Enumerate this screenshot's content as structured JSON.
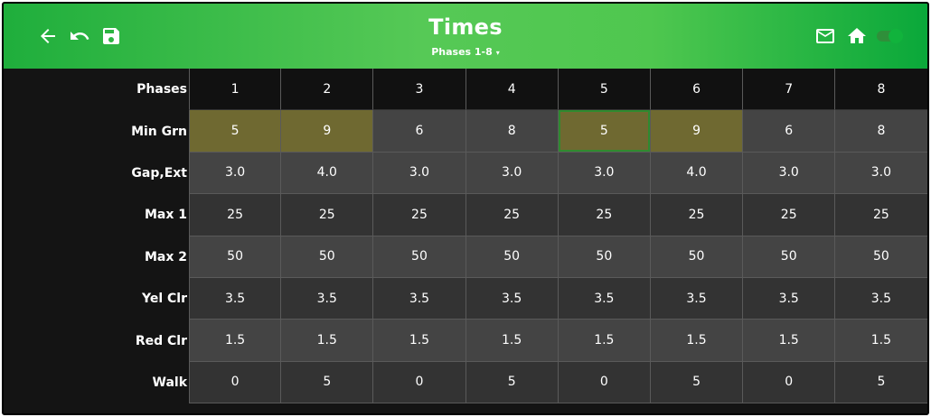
{
  "header": {
    "title": "Times",
    "subtitle": "Phases 1-8",
    "subtitle_caret": "▾"
  },
  "colors": {
    "header_green": "#4fc74f",
    "highlight_cell": "#6f6931",
    "selected_border": "#2f8a2f"
  },
  "table": {
    "header_label": "Phases",
    "phases": [
      "1",
      "2",
      "3",
      "4",
      "5",
      "6",
      "7",
      "8"
    ],
    "rows": [
      {
        "label": "Min Grn",
        "values": [
          "5",
          "9",
          "6",
          "8",
          "5",
          "9",
          "6",
          "8"
        ]
      },
      {
        "label": "Gap,Ext",
        "values": [
          "3.0",
          "4.0",
          "3.0",
          "3.0",
          "3.0",
          "4.0",
          "3.0",
          "3.0"
        ]
      },
      {
        "label": "Max 1",
        "values": [
          "25",
          "25",
          "25",
          "25",
          "25",
          "25",
          "25",
          "25"
        ]
      },
      {
        "label": "Max 2",
        "values": [
          "50",
          "50",
          "50",
          "50",
          "50",
          "50",
          "50",
          "50"
        ]
      },
      {
        "label": "Yel Clr",
        "values": [
          "3.5",
          "3.5",
          "3.5",
          "3.5",
          "3.5",
          "3.5",
          "3.5",
          "3.5"
        ]
      },
      {
        "label": "Red Clr",
        "values": [
          "1.5",
          "1.5",
          "1.5",
          "1.5",
          "1.5",
          "1.5",
          "1.5",
          "1.5"
        ]
      },
      {
        "label": "Walk",
        "values": [
          "0",
          "5",
          "0",
          "5",
          "0",
          "5",
          "0",
          "5"
        ]
      }
    ]
  }
}
